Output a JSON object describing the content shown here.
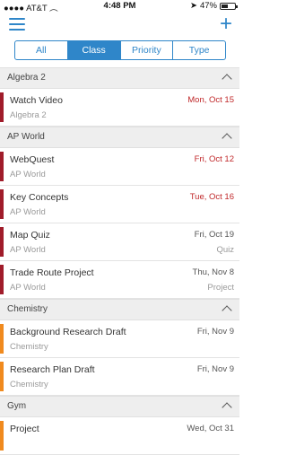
{
  "status_bar": {
    "carrier": "AT&T",
    "time": "4:48 PM",
    "battery": "47%",
    "battery_level": 0.47
  },
  "segments": [
    "All",
    "Class",
    "Priority",
    "Type"
  ],
  "active_segment": "Class",
  "colors": {
    "accent": "#2f86c9",
    "algebra": "#a01c2a",
    "ap_world": "#a01c2a",
    "chemistry": "#f08a1e",
    "gym": "#f08a1e",
    "overdue_date": "#c0282a"
  },
  "sections": [
    {
      "title": "Algebra 2",
      "items": [
        {
          "name": "Watch Video",
          "sub": "Algebra 2",
          "date": "Mon, Oct 15",
          "type": ""
        }
      ]
    },
    {
      "title": "AP World",
      "items": [
        {
          "name": "WebQuest",
          "sub": "AP World",
          "date": "Fri, Oct 12",
          "type": ""
        },
        {
          "name": "Key Concepts",
          "sub": "AP World",
          "date": "Tue, Oct 16",
          "type": ""
        },
        {
          "name": "Map Quiz",
          "sub": "AP World",
          "date": "Fri, Oct 19",
          "type": "Quiz"
        },
        {
          "name": "Trade Route Project",
          "sub": "AP World",
          "date": "Thu, Nov 8",
          "type": "Project"
        }
      ]
    },
    {
      "title": "Chemistry",
      "items": [
        {
          "name": "Background Research Draft",
          "sub": "Chemistry",
          "date": "Fri, Nov 9",
          "type": ""
        },
        {
          "name": "Research Plan Draft",
          "sub": "Chemistry",
          "date": "Fri, Nov 9",
          "type": ""
        }
      ]
    },
    {
      "title": "Gym",
      "items": [
        {
          "name": "Project",
          "sub": "",
          "date": "Wed, Oct 31",
          "type": ""
        }
      ]
    }
  ]
}
